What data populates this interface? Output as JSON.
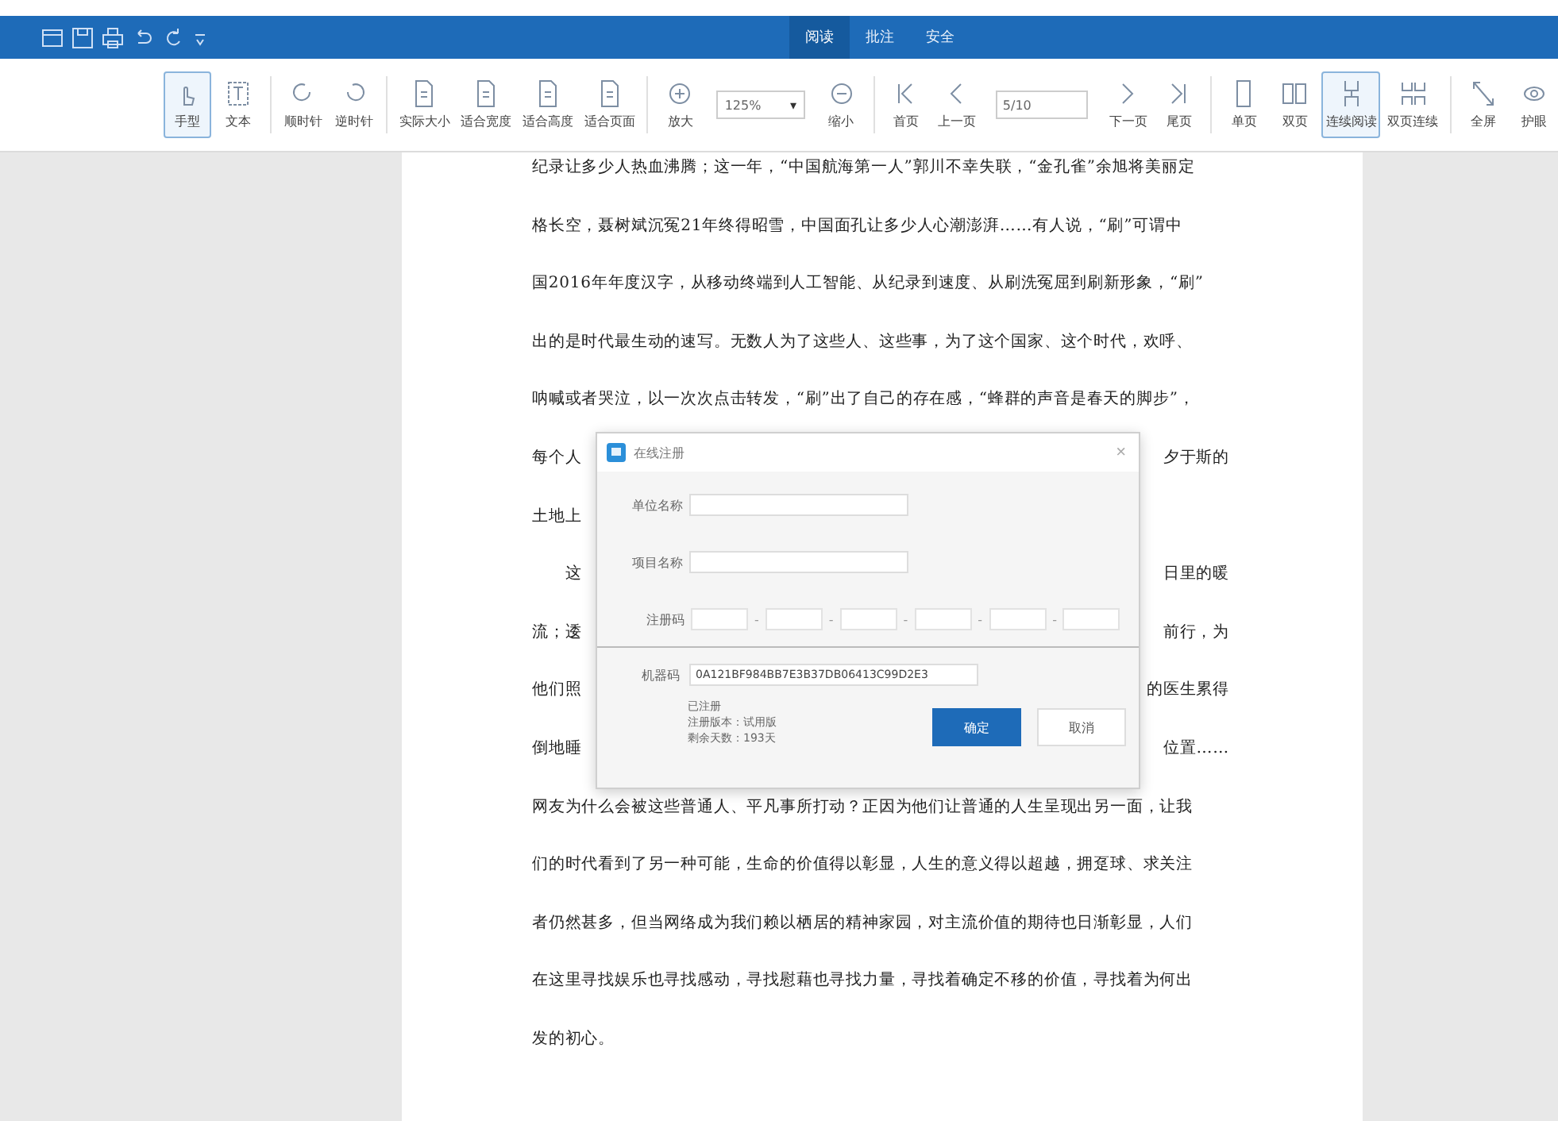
{
  "title_bar": {
    "tabs": [
      {
        "label": "阅读",
        "selected": true
      },
      {
        "label": "批注",
        "selected": false
      },
      {
        "label": "安全",
        "selected": false
      }
    ]
  },
  "toolbar": {
    "groups": [
      [
        {
          "kind": "button",
          "label": "手型",
          "selected": true
        },
        {
          "kind": "button",
          "label": "文本",
          "selected": false
        }
      ],
      [
        {
          "kind": "button",
          "label": "顺时针",
          "selected": false
        },
        {
          "kind": "button",
          "label": "逆时针",
          "selected": false
        }
      ],
      [
        {
          "kind": "button",
          "label": "实际大小",
          "selected": false
        },
        {
          "kind": "button",
          "label": "适合宽度",
          "selected": false
        },
        {
          "kind": "button",
          "label": "适合高度",
          "selected": false
        },
        {
          "kind": "button",
          "label": "适合页面",
          "selected": false
        }
      ],
      [
        {
          "kind": "button",
          "label": "放大",
          "selected": false
        },
        {
          "kind": "select",
          "value": "125%",
          "caret": "▾"
        },
        {
          "kind": "button",
          "label": "缩小",
          "selected": false
        }
      ],
      [
        {
          "kind": "button",
          "label": "首页",
          "selected": false
        },
        {
          "kind": "button",
          "label": "上一页",
          "selected": false
        },
        {
          "kind": "field",
          "value": "5/10"
        },
        {
          "kind": "button",
          "label": "下一页",
          "selected": false
        },
        {
          "kind": "button",
          "label": "尾页",
          "selected": false
        }
      ],
      [
        {
          "kind": "button",
          "label": "单页",
          "selected": false
        },
        {
          "kind": "button",
          "label": "双页",
          "selected": false
        },
        {
          "kind": "button",
          "label": "连续阅读",
          "selected": true
        },
        {
          "kind": "button",
          "label": "双页连续",
          "selected": false
        }
      ],
      [
        {
          "kind": "button",
          "label": "全屏",
          "selected": false
        },
        {
          "kind": "button",
          "label": "护眼",
          "selected": false
        }
      ]
    ]
  },
  "document": {
    "lines": [
      {
        "left": "纪录让多少人热血沸腾；这一年，“中国航海第一人”郭川不幸失联，“金孔雀”余旭将美丽定"
      },
      {
        "left": "格长空，聂树斌沉冤21年终得昭雪，中国面孔让多少人心潮澎湃……有人说，“刷”可谓中"
      },
      {
        "left": "国2016年年度汉字，从移动终端到人工智能、从纪录到速度、从刷洗冤屈到刷新形象，“刷”"
      },
      {
        "left": "出的是时代最生动的速写。无数人为了这些人、这些事，为了这个国家、这个时代，欢呼、"
      },
      {
        "left": "呐喊或者哭泣，以一次次点击转发，“刷”出了自己的存在感，“蜂群的声音是春天的脚步”，"
      },
      {
        "left": "每个人",
        "right": "夕于斯的"
      },
      {
        "left": "土地上"
      },
      {
        "left": "　　这",
        "right": "日里的暖"
      },
      {
        "left": "流；逶",
        "right": "前行，为"
      },
      {
        "left": "他们照",
        "right": "的医生累得"
      },
      {
        "left": "倒地睡",
        "right": "位置……"
      },
      {
        "left": "网友为什么会被这些普通人、平凡事所打动？正因为他们让普通的人生呈现出另一面，让我"
      },
      {
        "left": "们的时代看到了另一种可能，生命的价值得以彰显，人生的意义得以超越，拥趸球、求关注"
      },
      {
        "left": "者仍然甚多，但当网络成为我们赖以栖居的精神家园，对主流价值的期待也日渐彰显，人们"
      },
      {
        "left": "在这里寻找娱乐也寻找感动，寻找慰藉也寻找力量，寻找着确定不移的价值，寻找着为何出"
      },
      {
        "left": "发的初心。"
      }
    ]
  },
  "dialog": {
    "title": "在线注册",
    "close": "×",
    "unit_label": "单位名称",
    "project_label": "项目名称",
    "code_label": "注册码",
    "code_separator": "-",
    "machine_label": "机器码",
    "machine_code": "0A121BF984BB7E3B37DB06413C99D2E3",
    "status": [
      "已注册",
      "注册版本：试用版",
      "剩余天数：193天"
    ],
    "buttons": [
      {
        "kind": "primary",
        "label": "确定"
      },
      {
        "kind": "secondary",
        "label": "取消"
      }
    ]
  }
}
